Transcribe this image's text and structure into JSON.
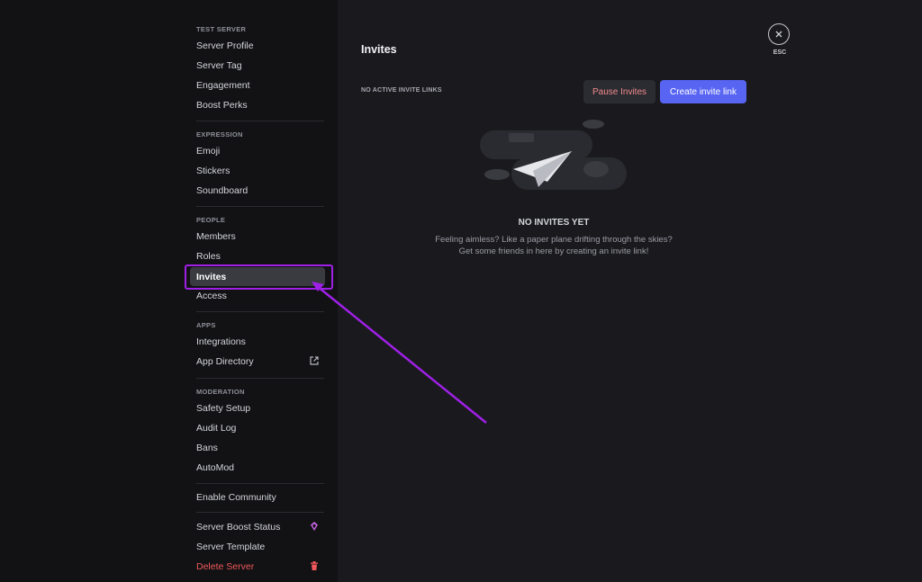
{
  "sidebar": {
    "sections": [
      {
        "title": "TEST SERVER",
        "items": [
          "Server Profile",
          "Server Tag",
          "Engagement",
          "Boost Perks"
        ]
      },
      {
        "title": "EXPRESSION",
        "items": [
          "Emoji",
          "Stickers",
          "Soundboard"
        ]
      },
      {
        "title": "PEOPLE",
        "items": [
          "Members",
          "Roles",
          "Invites",
          "Access"
        ]
      },
      {
        "title": "APPS",
        "items": [
          "Integrations",
          "App Directory"
        ]
      },
      {
        "title": "MODERATION",
        "items": [
          "Safety Setup",
          "Audit Log",
          "Bans",
          "AutoMod"
        ]
      },
      {
        "title": "",
        "items": [
          "Enable Community"
        ]
      },
      {
        "title": "",
        "items": [
          "Server Boost Status",
          "Server Template",
          "Delete Server"
        ]
      }
    ],
    "selected": "Invites"
  },
  "main": {
    "title": "Invites",
    "no_active_label": "NO ACTIVE INVITE LINKS",
    "pause_button": "Pause Invites",
    "create_button": "Create invite link",
    "empty_title": "NO INVITES YET",
    "empty_line1": "Feeling aimless? Like a paper plane drifting through the skies?",
    "empty_line2": "Get some friends in here by creating an invite link!"
  },
  "close": {
    "icon": "close-icon",
    "label": "ESC"
  },
  "colors": {
    "accent": "#5865f2",
    "danger": "#f0585b",
    "annotation": "#a020e8"
  }
}
